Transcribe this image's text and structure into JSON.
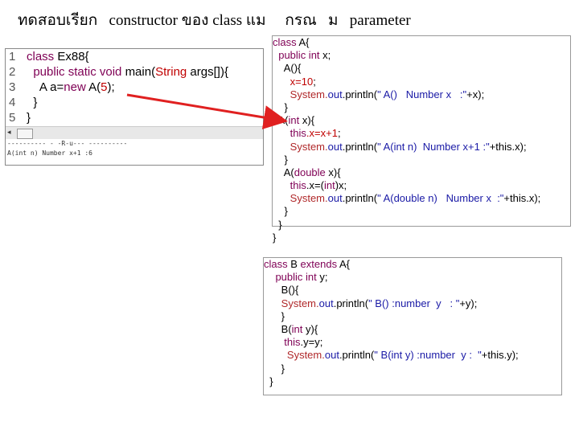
{
  "title": {
    "thai1": "ทดสอบเรียก",
    "eng1": "constructor",
    "thai2": "ของ",
    "eng2": "class แม",
    "thai3": "กรณ",
    "thai4": "ม",
    "eng3": "parameter"
  },
  "editor": {
    "line_numbers": [
      "1",
      "2",
      "3",
      "4",
      "5"
    ],
    "lines": [
      {
        "a": "class ",
        "b": "Ex88{"
      },
      {
        "a": "  public static void ",
        "b": "main(",
        "c": "String",
        "d": " args[]){"
      },
      {
        "a": "    A a=",
        "b": "new",
        "c": " A(",
        "d": "5",
        "e": ");"
      },
      {
        "a": "  }"
      },
      {
        "a": "}"
      }
    ],
    "scroll_arrow": "◂",
    "console": [
      "---------- - -R-u--- ----------",
      "A(int n) Number x+1 :6"
    ]
  },
  "classA": [
    {
      "p1": "class ",
      "p2": "A{"
    },
    {
      "p1": "  public int ",
      "p2": "x;"
    },
    {
      "p1": "    A(){"
    },
    {
      "p1": "      x=",
      "p2": "10",
      "p3": ";"
    },
    {
      "p1": "      System.",
      "p2": "out",
      "p3": ".println(",
      "p4": "\" A()   Number x   :\"",
      "p5": "+x);"
    },
    {
      "p1": "    }"
    },
    {
      "p1": "  A(",
      "p2": "int",
      "p3": " x){"
    },
    {
      "p1": "      this",
      "p2": ".x=x+",
      "p3": "1",
      "p4": ";"
    },
    {
      "p1": "      System.",
      "p2": "out",
      "p3": ".println(",
      "p4": "\" A(int n)  Number x+1 :\"",
      "p5": "+this.x);"
    },
    {
      "p1": "    }"
    },
    {
      "p1": "    A(",
      "p2": "double",
      "p3": " x){"
    },
    {
      "p1": "      this",
      "p2": ".x=(",
      "p3": "int",
      "p4": ")x;"
    },
    {
      "p1": "      System.",
      "p2": "out",
      "p3": ".println(",
      "p4": "\" A(double n)   Number x  :\"",
      "p5": "+this.x);"
    },
    {
      "p1": "    }"
    },
    {
      "p1": "  }"
    },
    {
      "p1": "}"
    }
  ],
  "classB": [
    {
      "p1": "class ",
      "p2": "B ",
      "p3": "extends",
      "p4": " A{"
    },
    {
      "p1": "    public int ",
      "p2": "y;"
    },
    {
      "p1": "      B(){"
    },
    {
      "p1": "      System.",
      "p2": "out",
      "p3": ".println(",
      "p4": "\" B() :number  y   : \"",
      "p5": "+y);"
    },
    {
      "p1": "      }"
    },
    {
      "p1": "      B(",
      "p2": "int",
      "p3": " y){"
    },
    {
      "p1": "       this",
      "p2": ".y=y;"
    },
    {
      "p1": "        System.",
      "p2": "out",
      "p3": ".println(",
      "p4": "\" B(int y) :number  y :  \"",
      "p5": "+this.y);"
    },
    {
      "p1": "      }"
    },
    {
      "p1": "  }"
    }
  ],
  "colors": {
    "arrow": "#e02020",
    "keyword": "#7f0055",
    "string": "#1a1aa6"
  }
}
